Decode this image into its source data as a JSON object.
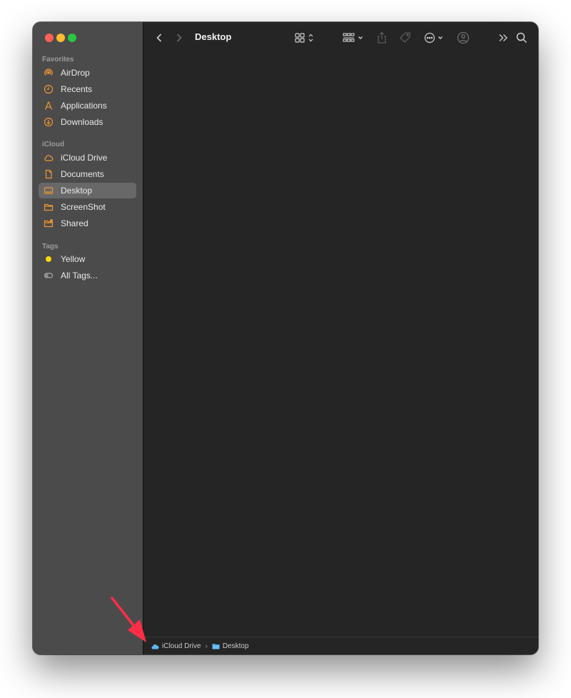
{
  "window": {
    "title": "Desktop"
  },
  "sidebar": {
    "favorites_label": "Favorites",
    "favorites": [
      {
        "label": "AirDrop",
        "icon": "airdrop-icon"
      },
      {
        "label": "Recents",
        "icon": "clock-icon"
      },
      {
        "label": "Applications",
        "icon": "applications-icon"
      },
      {
        "label": "Downloads",
        "icon": "download-icon"
      }
    ],
    "icloud_label": "iCloud",
    "icloud": [
      {
        "label": "iCloud Drive",
        "icon": "cloud-icon"
      },
      {
        "label": "Documents",
        "icon": "document-icon"
      },
      {
        "label": "Desktop",
        "icon": "desktop-icon",
        "selected": true
      },
      {
        "label": "ScreenShot",
        "icon": "folder-icon"
      },
      {
        "label": "Shared",
        "icon": "shared-folder-icon"
      }
    ],
    "tags_label": "Tags",
    "tags": [
      {
        "label": "Yellow",
        "icon": "yellow-tag-dot",
        "color": "#ffd60a"
      },
      {
        "label": "All Tags...",
        "icon": "all-tags-icon"
      }
    ]
  },
  "pathbar": {
    "items": [
      {
        "label": "iCloud Drive",
        "icon": "cloud-icon"
      },
      {
        "label": "Desktop",
        "icon": "folder-icon"
      }
    ]
  },
  "colors": {
    "accent": "#f0962f",
    "annotation_arrow": "#ff2d46"
  }
}
